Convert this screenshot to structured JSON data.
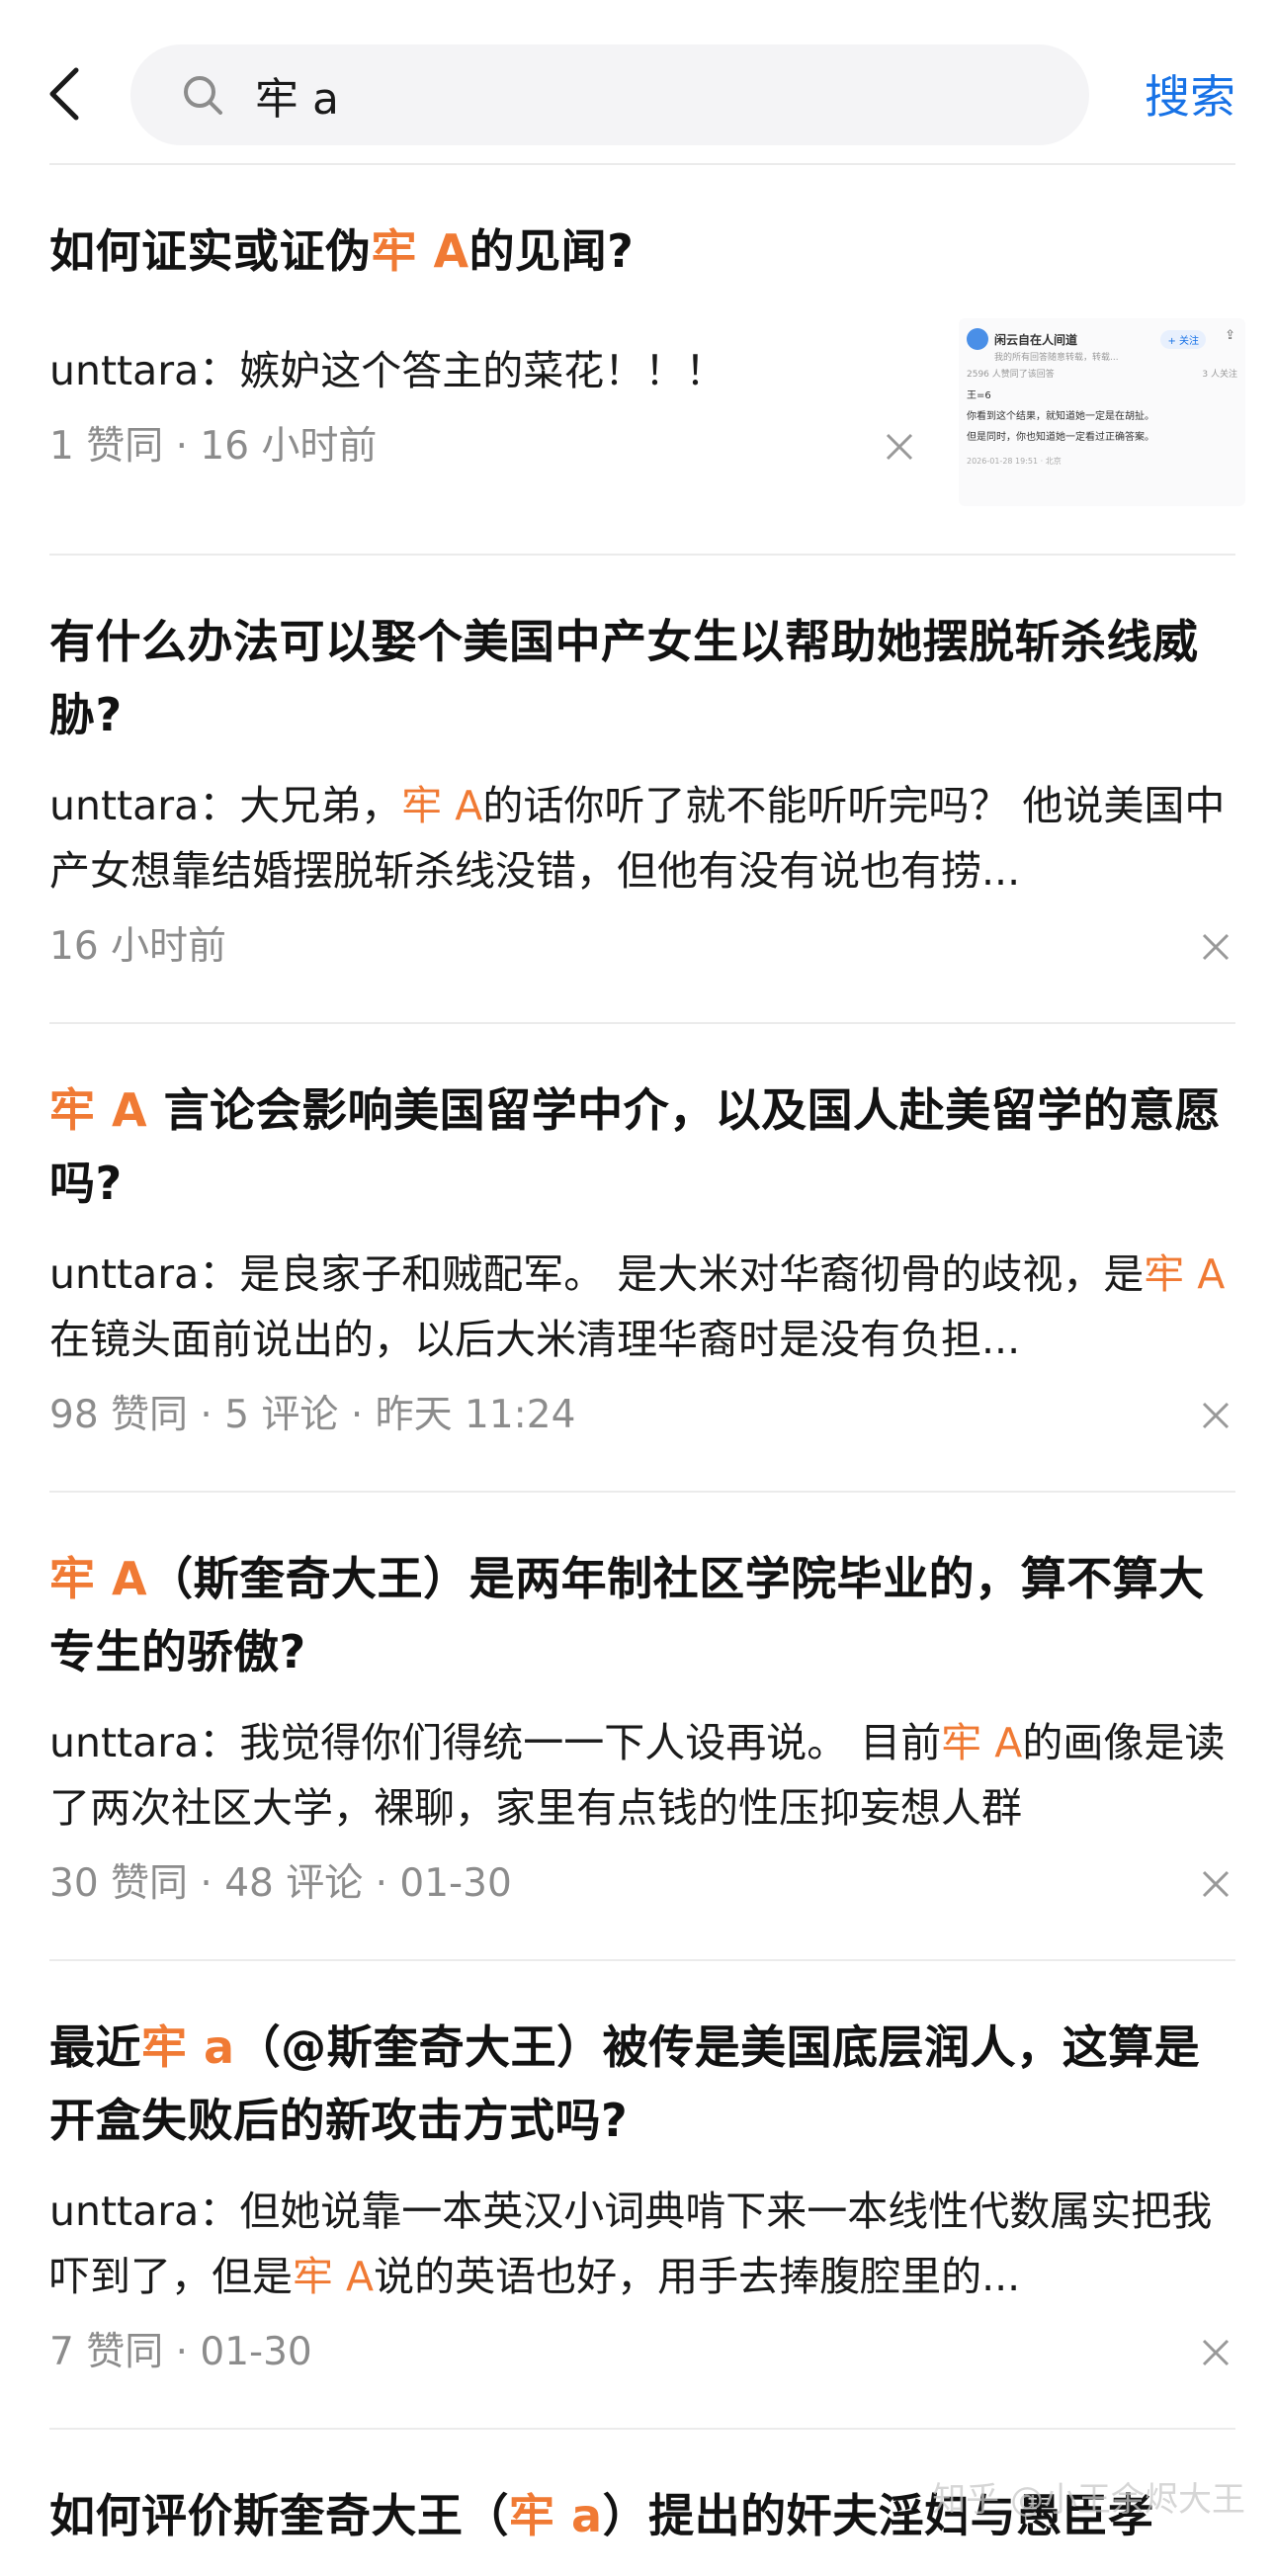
{
  "search": {
    "query": "牢 a",
    "submit_label": "搜索"
  },
  "results": [
    {
      "title_parts": [
        "如何证实或证伪",
        "牢 A",
        "的见闻?"
      ],
      "excerpt_parts": [
        "unttara：嫉妒这个答主的菜花！！！"
      ],
      "meta": "1 赞同 · 16 小时前",
      "thumbnail": {
        "account": "闲云自在人间道",
        "follow": "+ 关注",
        "bio": "我的所有回答随意转载，转载...",
        "stats_left": "2596 人赞同了该回答",
        "stats_right": "3 人关注",
        "line1": "王=6",
        "line2": "你看到这个结果，就知道她一定是在胡扯。",
        "line3": "但是同时，你也知道她一定看过正确答案。",
        "footer": "2026-01-28 19:51 · 北京"
      }
    },
    {
      "title_parts": [
        "有什么办法可以娶个美国中产女生以帮助她摆脱斩杀线威胁?"
      ],
      "excerpt_parts": [
        "unttara：大兄弟，",
        "牢 A",
        "的话你听了就不能听听完吗？ 他说美国中产女想靠结婚摆脱斩杀线没错，但他有没有说也有捞..."
      ],
      "meta": "16 小时前"
    },
    {
      "title_parts": [
        "牢 A",
        " 言论会影响美国留学中介，以及国人赴美留学的意愿吗?"
      ],
      "excerpt_parts": [
        "unttara：是良家子和贼配军。 是大米对华裔彻骨的歧视，是",
        "牢 A",
        "在镜头面前说出的，以后大米清理华裔时是没有负担..."
      ],
      "meta": "98 赞同 · 5 评论 · 昨天 11:24"
    },
    {
      "title_parts": [
        "牢 A",
        "（斯奎奇大王）是两年制社区学院毕业的，算不算大专生的骄傲?"
      ],
      "excerpt_parts": [
        "unttara：我觉得你们得统一一下人设再说。 目前",
        "牢 A",
        "的画像是读了两次社区大学，裸聊，家里有点钱的性压抑妄想人群"
      ],
      "meta": "30 赞同 · 48 评论 · 01-30"
    },
    {
      "title_parts": [
        "最近",
        "牢 a",
        "（@斯奎奇大王）被传是美国底层润人，这算是开盒失败后的新攻击方式吗?"
      ],
      "excerpt_parts": [
        "unttara：但她说靠一本英汉小词典啃下来一本线性代数属实把我吓到了，但是",
        "牢 A",
        "说的英语也好，用手去捧腹腔里的..."
      ],
      "meta": "7 赞同 · 01-30"
    },
    {
      "title_parts": [
        "如何评价斯奎奇大王（",
        "牢 a",
        "）提出的奸夫淫妇与愚臣孝"
      ]
    }
  ],
  "watermark": "知乎 @小王余烬大王",
  "colors": {
    "highlight": "#f07a34",
    "link": "#1772e6",
    "meta": "#8c8c8c"
  }
}
